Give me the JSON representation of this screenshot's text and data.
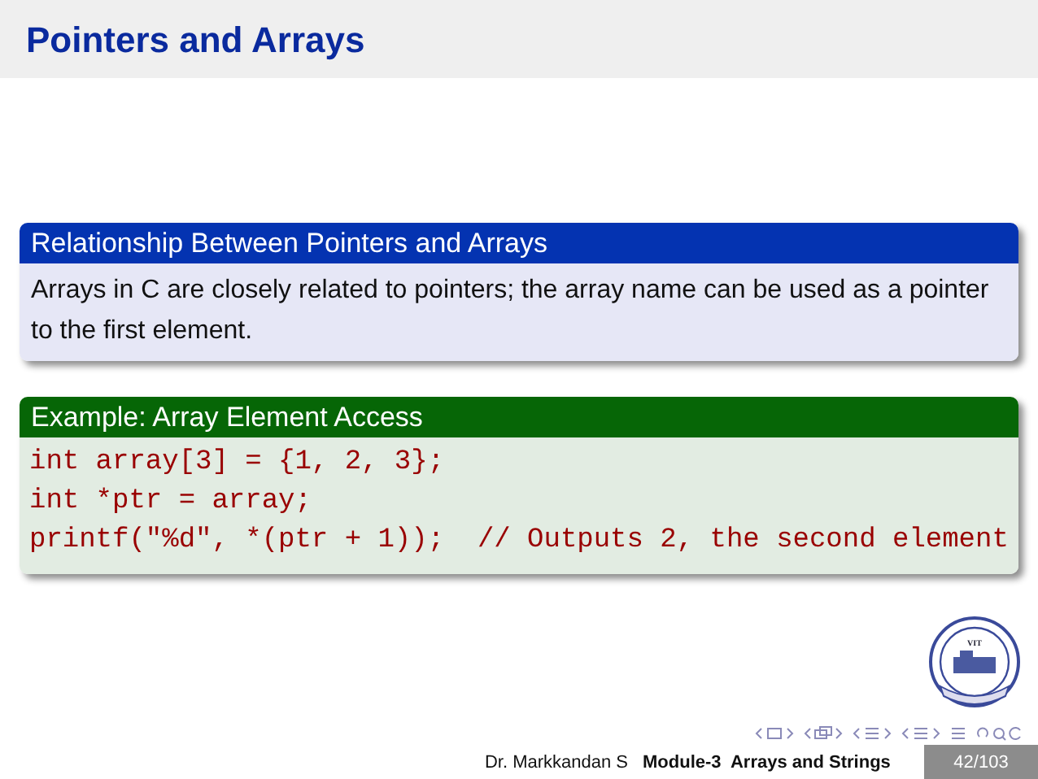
{
  "frame_title": "Pointers and Arrays",
  "blocks": [
    {
      "kind": "definition",
      "title": "Relationship Between Pointers and Arrays",
      "text": "Arrays in C are closely related to pointers; the array name can be used as a pointer to the first element."
    },
    {
      "kind": "example",
      "title": "Example: Array Element Access",
      "code_lines": [
        "int array[3] = {1, 2, 3};",
        "int *ptr = array;",
        "printf(\"%d\", *(ptr + 1));  // Outputs 2, the second element"
      ]
    }
  ],
  "logo": {
    "text": "VIT"
  },
  "footer": {
    "author": "Dr. Markkandan S",
    "title": "Module-3  Arrays and Strings",
    "page": "42/103"
  }
}
